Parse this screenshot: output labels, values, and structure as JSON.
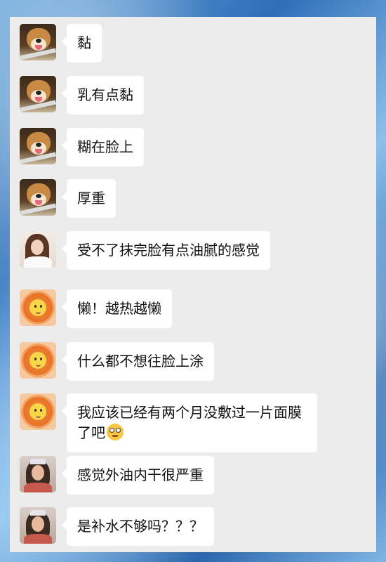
{
  "messages": [
    {
      "avatar": "dog-avatar",
      "text": "黏"
    },
    {
      "avatar": "dog-avatar",
      "text": "乳有点黏"
    },
    {
      "avatar": "dog-avatar",
      "text": "糊在脸上"
    },
    {
      "avatar": "dog-avatar",
      "text": "厚重"
    },
    {
      "avatar": "girl-avatar",
      "text": "受不了抹完脸有点油腻的感觉"
    },
    {
      "avatar": "lion-avatar",
      "text": "懒！越热越懒"
    },
    {
      "avatar": "lion-avatar",
      "text": "什么都不想往脸上涂"
    },
    {
      "avatar": "lion-avatar",
      "text": "我应该已经有两个月没敷过一片面膜了吧",
      "emoji": "rolling-eyes-emoji"
    },
    {
      "avatar": "crown-girl-avatar",
      "text": "感觉外油内干很严重"
    },
    {
      "avatar": "crown-girl-avatar",
      "text": "是补水不够吗？？？"
    }
  ]
}
